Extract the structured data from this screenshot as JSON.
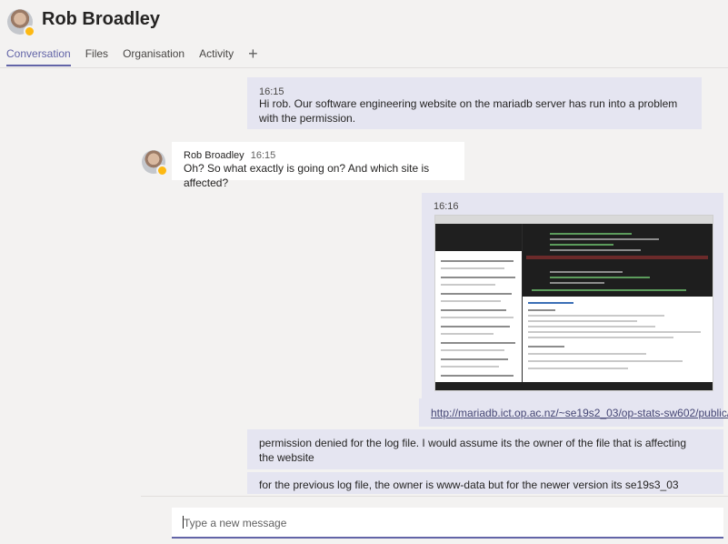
{
  "header": {
    "title": "Rob Broadley",
    "tabs": [
      "Conversation",
      "Files",
      "Organisation",
      "Activity"
    ],
    "add_tab_icon": "plus-icon"
  },
  "messages": [
    {
      "direction": "sent",
      "time": "16:15",
      "text": "Hi rob. Our software engineering website on the mariadb server has run into a problem with the permission."
    },
    {
      "direction": "received",
      "sender": "Rob Broadley",
      "time": "16:15",
      "text": "Oh? So what exactly is going on? And which site is affected?"
    },
    {
      "direction": "sent",
      "time": "16:16",
      "attachment": "screenshot",
      "link": "http://mariadb.ict.op.ac.nz/~se19s2_03/op-stats-sw602/public/"
    },
    {
      "direction": "sent",
      "text": "permission denied for the log file. I would assume its the owner of the file that is affecting the website"
    },
    {
      "direction": "sent",
      "text": "for the previous log file, the owner is www-data but for the newer version its se19s3_03"
    }
  ],
  "compose": {
    "placeholder": "Type a new message"
  },
  "colors": {
    "accent": "#6264a7",
    "sent_bubble": "#e5e5f1",
    "received_bubble": "#ffffff",
    "background": "#f3f2f1"
  }
}
